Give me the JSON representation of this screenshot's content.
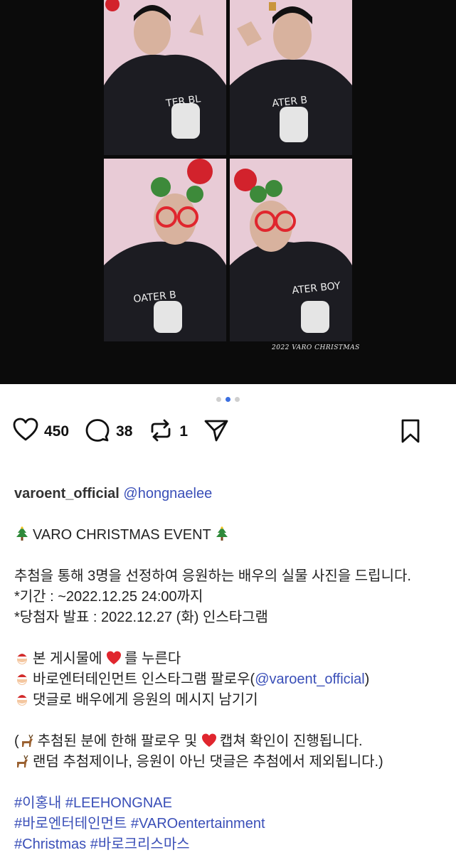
{
  "photo": {
    "watermark": "2022 VARO CHRISTMAS",
    "carousel": {
      "total": 3,
      "active_index": 1
    }
  },
  "actions": {
    "likes": "450",
    "comments": "38",
    "reposts": "1"
  },
  "post": {
    "username": "varoent_official",
    "mention": "@hongnaelee",
    "title": "VARO CHRISTMAS EVENT",
    "line1": "추첨을 통해 3명을 선정하여 응원하는 배우의 실물 사진을 드립니다.",
    "line2": "*기간 : ~2022.12.25 24:00까지",
    "line3": "*당첨자 발표 : 2022.12.27 (화) 인스타그램",
    "step1_a": "본 게시물에",
    "step1_b": "를 누른다",
    "step2_a": "바로엔터테인먼트 인스타그램 팔로우(",
    "step2_mention": "@varoent_official",
    "step2_b": ")",
    "step3": "댓글로 배우에게 응원의 메시지 남기기",
    "note1_a": "(",
    "note1_b": "추첨된 분에 한해 팔로우 및",
    "note1_c": "캡쳐 확인이 진행됩니다.",
    "note2": "랜덤 추첨제이나, 응원이 아닌 댓글은 추첨에서 제외됩니다.)",
    "hashtags_line1": [
      "#이홍내",
      "#LEEHONGNAE"
    ],
    "hashtags_line2": [
      "#바로엔터테인먼트",
      "#VAROentertainment"
    ],
    "hashtags_line3": [
      "#Christmas",
      "#바로크리스마스"
    ]
  },
  "colors": {
    "accent_blue": "#3b6fe0",
    "link": "#3a4fb8",
    "photo_background": "#e6c9d4",
    "heart_red": "#e0262e"
  }
}
